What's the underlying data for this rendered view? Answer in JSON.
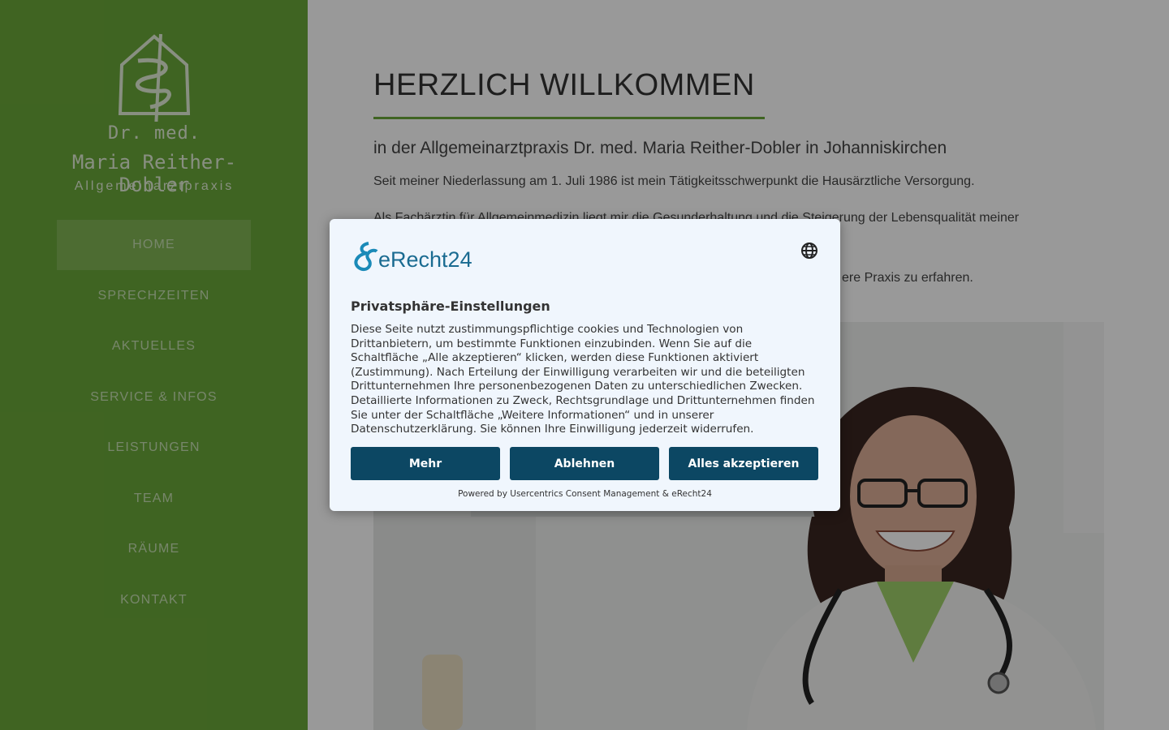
{
  "sidebar": {
    "logo": {
      "line1": "Dr. med.",
      "line2": "Maria Reither-Dobler",
      "line3": "Allgemeinarztpraxis"
    },
    "nav": [
      {
        "label": "HOME",
        "active": true
      },
      {
        "label": "SPRECHZEITEN"
      },
      {
        "label": "AKTUELLES"
      },
      {
        "label": "SERVICE & INFOS"
      },
      {
        "label": "LEISTUNGEN"
      },
      {
        "label": "TEAM"
      },
      {
        "label": "RÄUME"
      },
      {
        "label": "KONTAKT"
      }
    ]
  },
  "main": {
    "title": "HERZLICH WILLKOMMEN",
    "subtitle": "in der Allgemeinarztpraxis Dr. med. Maria Reither-Dobler in Johanniskirchen",
    "p1": "Seit meiner Niederlassung am 1. Juli 1986 ist mein Tätigkeitsschwerpunkt die Hausärztliche Versorgung.",
    "p2": "Als Fachärztin für Allgemeinmedizin liegt mir die Gesunderhaltung und die Steigerung der Lebensqualität meiner",
    "p3": "ere Praxis zu erfahren."
  },
  "consent": {
    "brand": "eRecht24",
    "heading": "Privatsphäre-Einstellungen",
    "description": "Diese Seite nutzt zustimmungspflichtige cookies und Technologien von Drittanbietern, um bestimmte Funktionen einzubinden. Wenn Sie auf die Schaltfläche „Alle akzeptieren“ klicken, werden diese Funktionen aktiviert (Zustimmung). Nach Erteilung der Einwilligung verarbeiten wir und die beteiligten Drittunternehmen Ihre personenbezogenen Daten zu unterschiedlichen Zwecken. Detaillierte Informationen zu Zweck, Rechtsgrundlage und Drittunternehmen finden Sie unter der Schaltfläche „Weitere Informationen“ und in unserer Datenschutzerklärung. Sie können Ihre Einwilligung jederzeit widerrufen.",
    "btn_more": "Mehr",
    "btn_deny": "Ablehnen",
    "btn_accept": "Alles akzeptieren",
    "powered": "Powered by Usercentrics Consent Management & eRecht24"
  },
  "colors": {
    "sidebar": "#6aa739",
    "accent": "#6aa739",
    "button": "#0c4763"
  }
}
